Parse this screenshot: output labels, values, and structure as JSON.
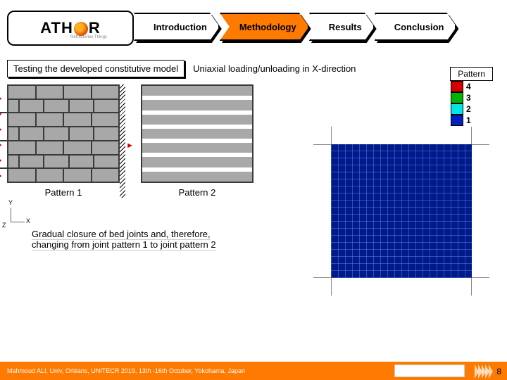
{
  "logo": {
    "text_before": "ATH",
    "text_after": "R",
    "subtext": "Refractories Things"
  },
  "nav": [
    {
      "label": "Introduction",
      "active": false
    },
    {
      "label": "Methodology",
      "active": true
    },
    {
      "label": "Results",
      "active": false
    },
    {
      "label": "Conclusion",
      "active": false
    }
  ],
  "subtitle_box": "Testing the developed constitutive model",
  "subtitle_text": "Uniaxial loading/unloading in X-direction",
  "pattern_box_label": "Pattern",
  "pattern1_caption": "Pattern 1",
  "pattern2_caption": "Pattern 2",
  "axes": {
    "y": "Y",
    "x": "X",
    "z": "Z"
  },
  "description_line1": "Gradual closure of bed joints and, therefore,",
  "description_line2": "changing from joint pattern 1 to joint pattern 2",
  "legend": [
    {
      "color": "#d40000",
      "label": "4"
    },
    {
      "color": "#00b200",
      "label": "3"
    },
    {
      "color": "#00e5e5",
      "label": "2"
    },
    {
      "color": "#0020c0",
      "label": "1"
    }
  ],
  "footer_text": "Mahmoud ALI, Univ, Orléans, UNITECR 2019, 13th -16th October, Yokohama, Japan",
  "page_number": "8"
}
